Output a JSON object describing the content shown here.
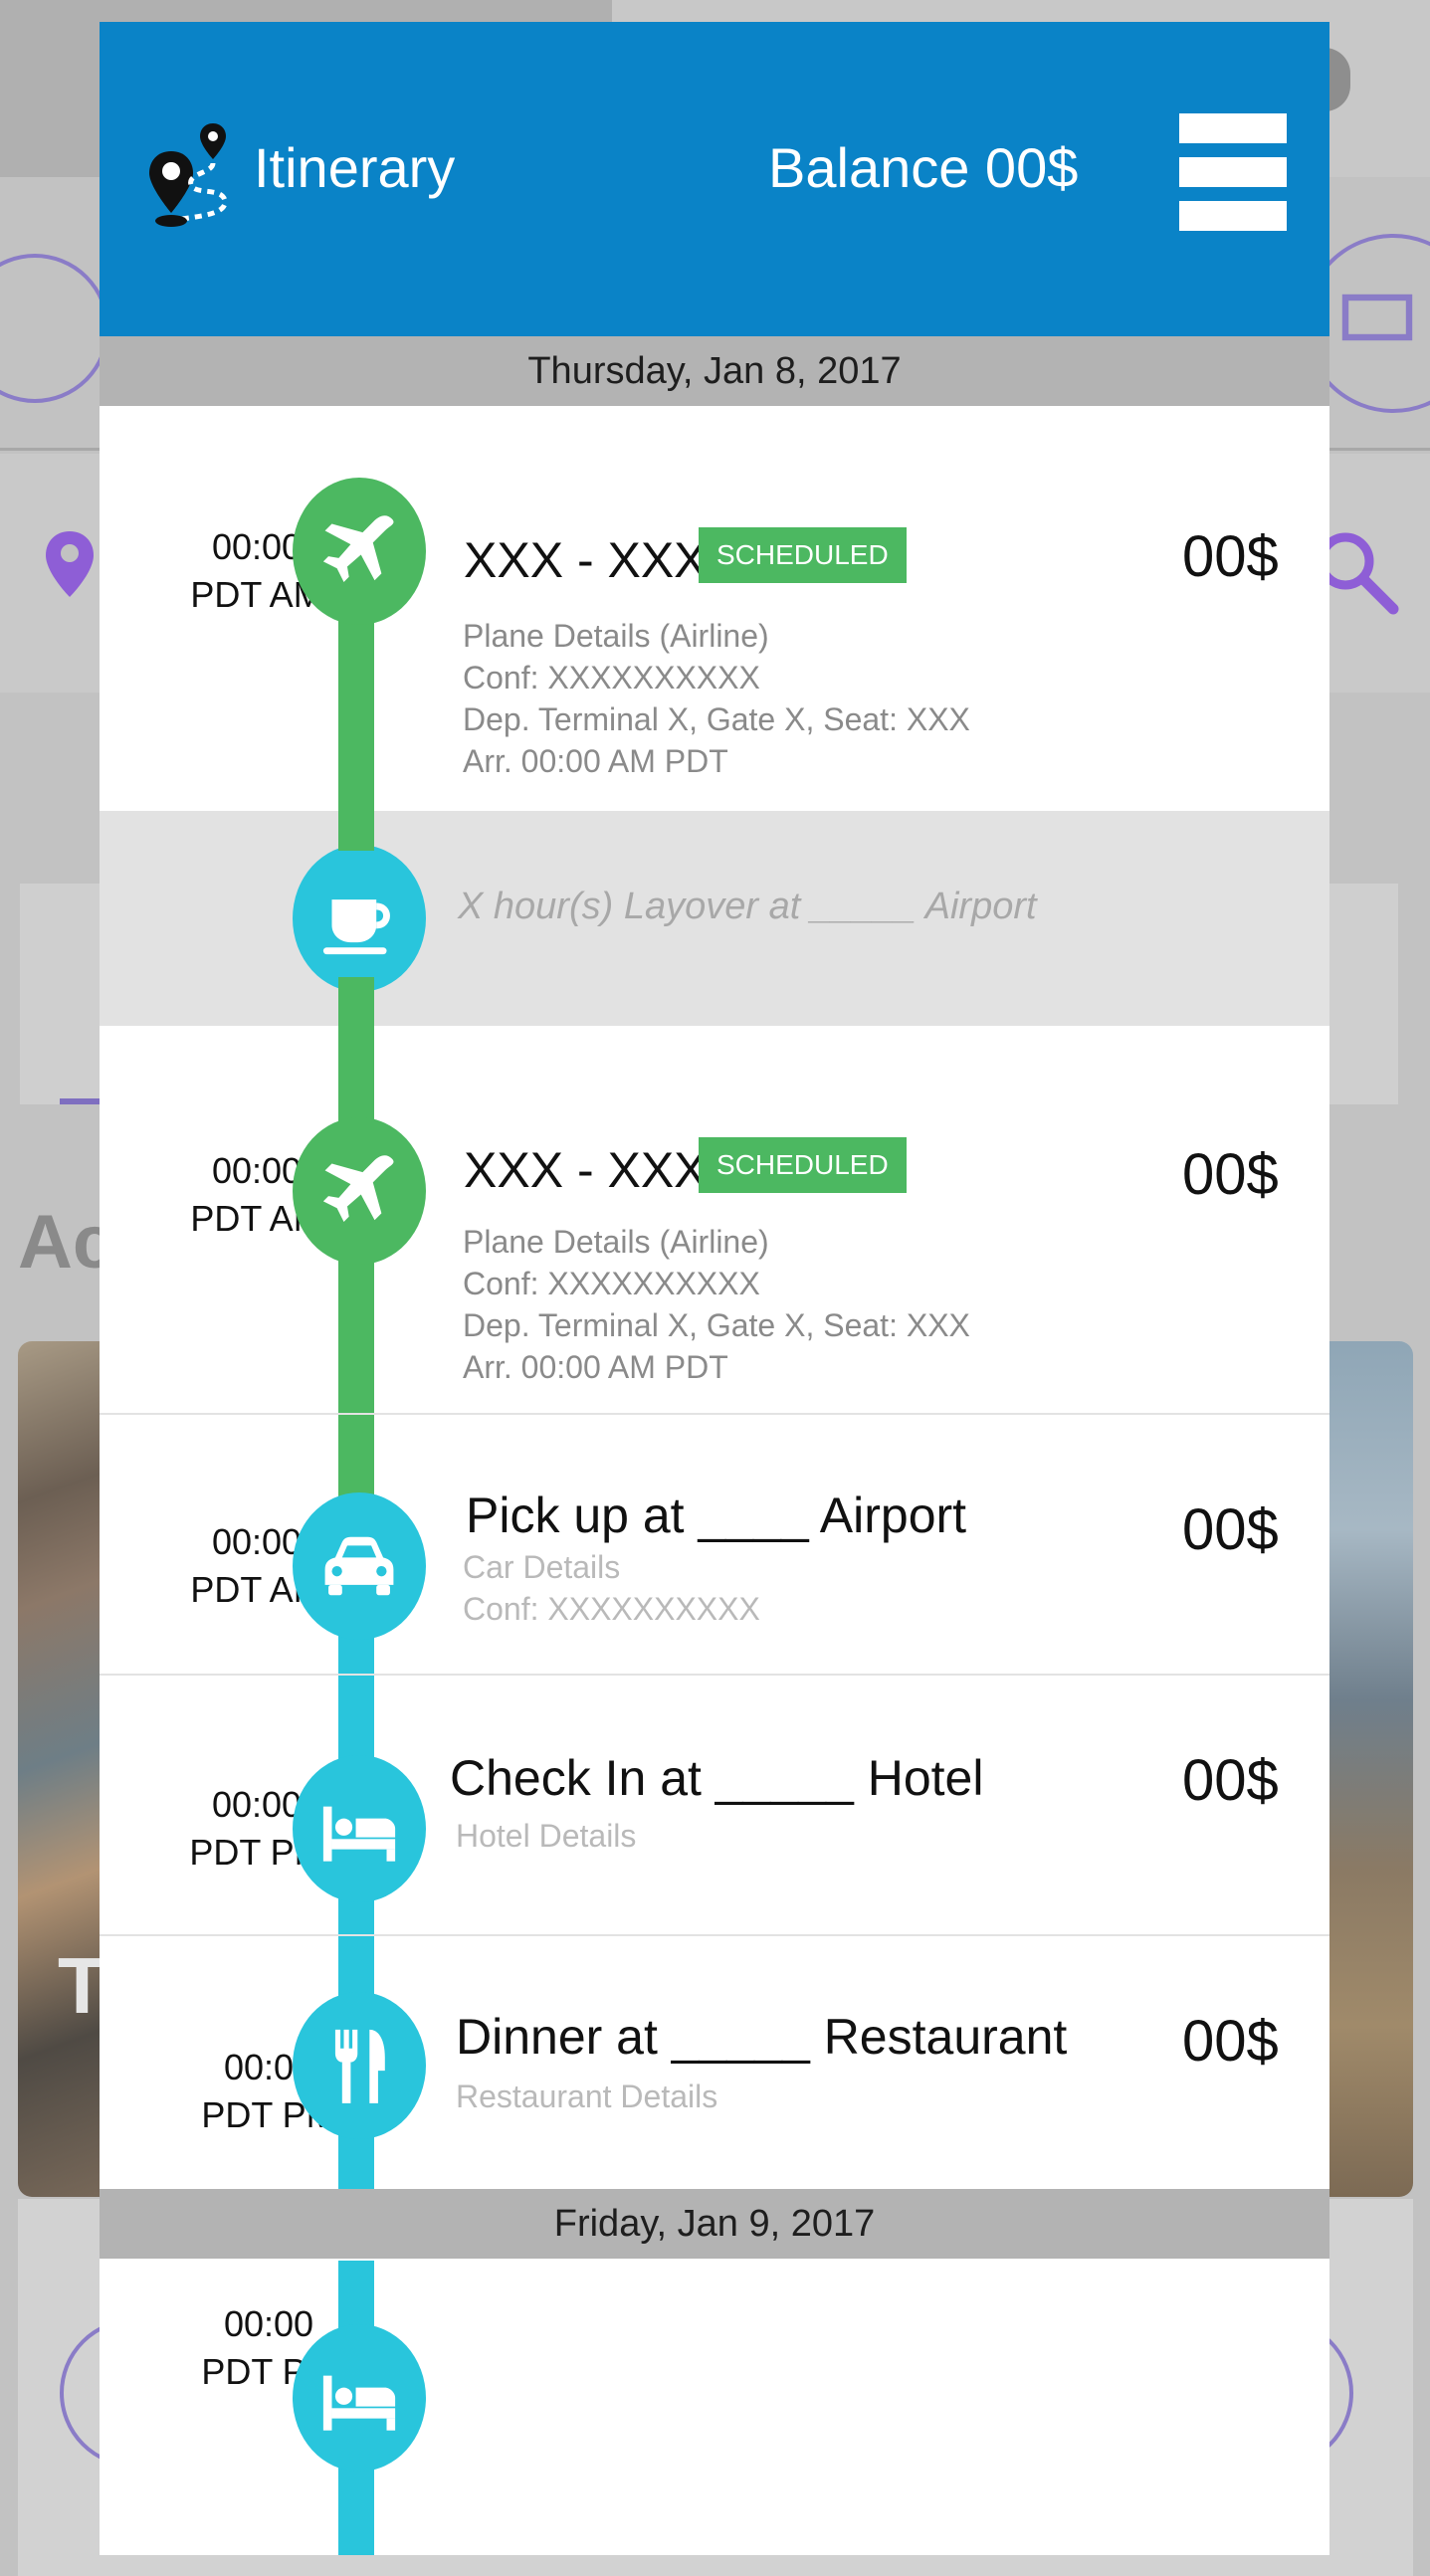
{
  "header": {
    "app_title": "Itinerary",
    "balance": "Balance 00$",
    "accent_color": "#0a83c7",
    "logo_icon": "location-route-icon",
    "menu_icon": "hamburger-menu-icon"
  },
  "days": [
    {
      "date": "Thursday, Jan 8, 2017"
    },
    {
      "date": "Friday, Jan 9, 2017"
    }
  ],
  "items": [
    {
      "time": "00:00",
      "period": "PDT AM",
      "icon": "airplane-icon",
      "color": "#4cb861",
      "title": "XXX - XXX",
      "badge": "SCHEDULED",
      "price": "00$",
      "details": [
        "Plane Details (Airline)",
        "Conf: XXXXXXXXXX",
        "Dep. Terminal X, Gate X, Seat: XXX",
        "Arr. 00:00 AM PDT"
      ]
    },
    {
      "type": "layover",
      "icon": "coffee-cup-icon",
      "color": "#29c5dc",
      "text": "X hour(s) Layover at _____ Airport"
    },
    {
      "time": "00:00",
      "period": "PDT AM",
      "icon": "airplane-icon",
      "color": "#4cb861",
      "title": "XXX - XXX",
      "badge": "SCHEDULED",
      "price": "00$",
      "details": [
        "Plane Details (Airline)",
        "Conf: XXXXXXXXXX",
        "Dep. Terminal X, Gate X, Seat: XXX",
        "Arr. 00:00 AM PDT"
      ]
    },
    {
      "time": "00:00",
      "period": "PDT AM",
      "icon": "car-icon",
      "color": "#29c5dc",
      "title": "Pick up at ____ Airport",
      "price": "00$",
      "details": [
        "Car Details",
        "Conf: XXXXXXXXXX"
      ]
    },
    {
      "time": "00:00",
      "period": "PDT PM",
      "icon": "bed-icon",
      "color": "#29c5dc",
      "title": "Check In at _____ Hotel",
      "price": "00$",
      "details": [
        "Hotel Details"
      ]
    },
    {
      "time": "00:00",
      "period": "PDT PM",
      "icon": "fork-knife-icon",
      "color": "#29c5dc",
      "title": "Dinner at _____ Restaurant",
      "price": "00$",
      "details": [
        "Restaurant Details"
      ]
    },
    {
      "time": "00:00",
      "period": "PDT PM",
      "icon": "bed-icon",
      "color": "#29c5dc"
    }
  ],
  "background": {
    "heading_fragment": "Ac",
    "photo_letter": "T"
  }
}
